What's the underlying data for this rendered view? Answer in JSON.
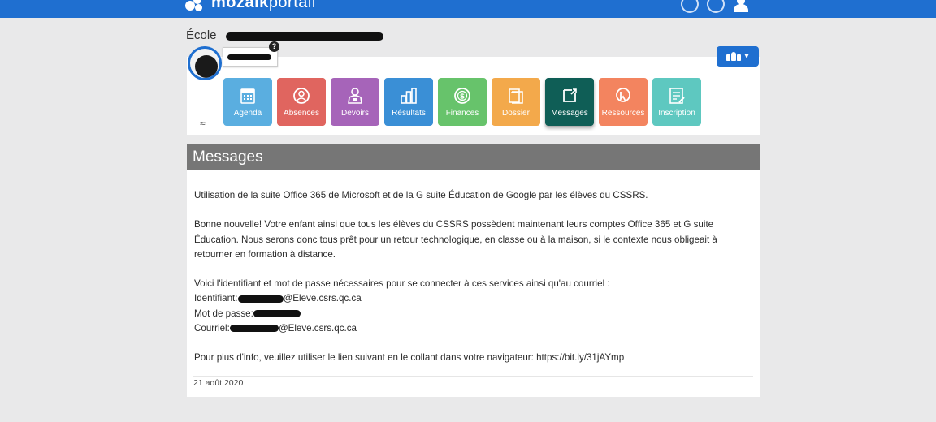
{
  "topbar": {
    "logo_bold": "mozaik",
    "logo_light": "portail",
    "icons": [
      "help-circle-icon",
      "info-circle-icon",
      "user-icon"
    ],
    "color": "#1f6fd0"
  },
  "school": {
    "label": "École"
  },
  "profile": {
    "help_badge": "?",
    "avatar_icon": "avatar"
  },
  "group_button": {
    "icon": "users-icon",
    "caret": "▾"
  },
  "collapse": {
    "glyph": "≈"
  },
  "tiles": [
    {
      "label": "Agenda",
      "color": "#5aaee0",
      "icon": "calendar-icon"
    },
    {
      "label": "Absences",
      "color": "#e0655f",
      "icon": "person-circle-icon"
    },
    {
      "label": "Devoirs",
      "color": "#a664b9",
      "icon": "student-icon"
    },
    {
      "label": "Résultats",
      "color": "#3a8fd6",
      "icon": "bar-chart-icon"
    },
    {
      "label": "Finances",
      "color": "#67c36b",
      "icon": "dollar-icon"
    },
    {
      "label": "Dossier",
      "color": "#f3a94b",
      "icon": "folder-icon"
    },
    {
      "label": "Messages",
      "color": "#0f5e56",
      "icon": "message-icon",
      "active": true
    },
    {
      "label": "Ressources",
      "color": "#f3845f",
      "icon": "resources-icon"
    },
    {
      "label": "Inscription",
      "color": "#5ec8c0",
      "icon": "form-icon"
    }
  ],
  "messages": {
    "title": "Messages",
    "para1": "Utilisation de la suite Office 365 de Microsoft et de la G suite Éducation de Google par les élèves du CSSRS.",
    "para2": "Bonne nouvelle!  Votre enfant ainsi que tous les élèves du CSSRS possèdent maintenant leurs comptes Office 365 et G suite Éducation. Nous serons donc tous prêt pour un retour technologique, en classe ou à la maison, si le contexte nous obligeait à retourner en formation à distance.",
    "para3": "Voici l'identifiant et mot de passe nécessaires pour se connecter à ces services ainsi qu'au courriel :",
    "id_label": "Identifiant:",
    "id_domain": "@Eleve.csrs.qc.ca",
    "pw_label": "Mot de passe:",
    "mail_label": "Courriel:",
    "mail_domain": "@Eleve.csrs.qc.ca",
    "para4": "Pour plus d'info, veuillez utiliser le lien suivant en le collant dans votre navigateur: https://bit.ly/31jAYmp",
    "date": "21 août 2020"
  }
}
